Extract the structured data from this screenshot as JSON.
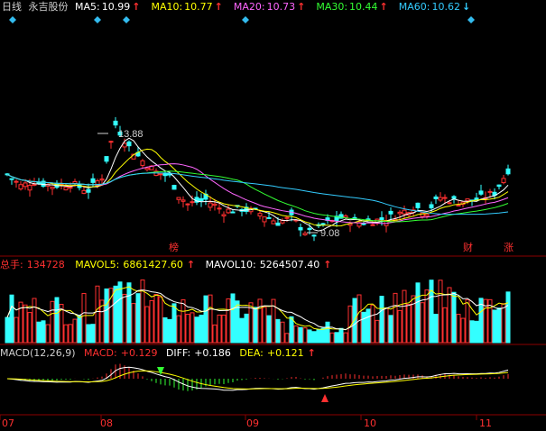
{
  "price_header": {
    "period": "日线",
    "stock_name": "永吉股份",
    "ma": [
      {
        "label": "MA5:",
        "value": "10.99",
        "arrow": "↑",
        "color": "#ffffff"
      },
      {
        "label": "MA10:",
        "value": "10.77",
        "arrow": "↑",
        "color": "#ffff00"
      },
      {
        "label": "MA20:",
        "value": "10.73",
        "arrow": "↑",
        "color": "#ff66ff"
      },
      {
        "label": "MA30:",
        "value": "10.44",
        "arrow": "↑",
        "color": "#33ff33"
      },
      {
        "label": "MA60:",
        "value": "10.62",
        "arrow": "↓",
        "color": "#33ccff"
      }
    ]
  },
  "volume_header": {
    "total_label": "总手:",
    "total_value": "134728",
    "mavol5_label": "MAVOL5:",
    "mavol5_value": "6861427.60",
    "mavol10_label": "MAVOL10:",
    "mavol10_value": "5264507.40",
    "arrow": "↑"
  },
  "macd_header": {
    "name": "MACD(12,26,9)",
    "macd_label": "MACD:",
    "macd_value": "+0.129",
    "diff_label": "DIFF:",
    "diff_value": "+0.186",
    "dea_label": "DEA:",
    "dea_value": "+0.121",
    "arrow": "↑"
  },
  "annotations": {
    "high": "13.88",
    "low": "9.08",
    "markers": [
      "榜",
      "财",
      "涨"
    ]
  },
  "x_axis": [
    "07",
    "08",
    "09",
    "10",
    "11"
  ],
  "colors": {
    "up": "#ff3030",
    "down": "#33ffff",
    "ma5": "#ffffff",
    "ma10": "#ffff00",
    "ma20": "#ff66ff",
    "ma30": "#33ff33",
    "ma60": "#33ccff"
  }
}
